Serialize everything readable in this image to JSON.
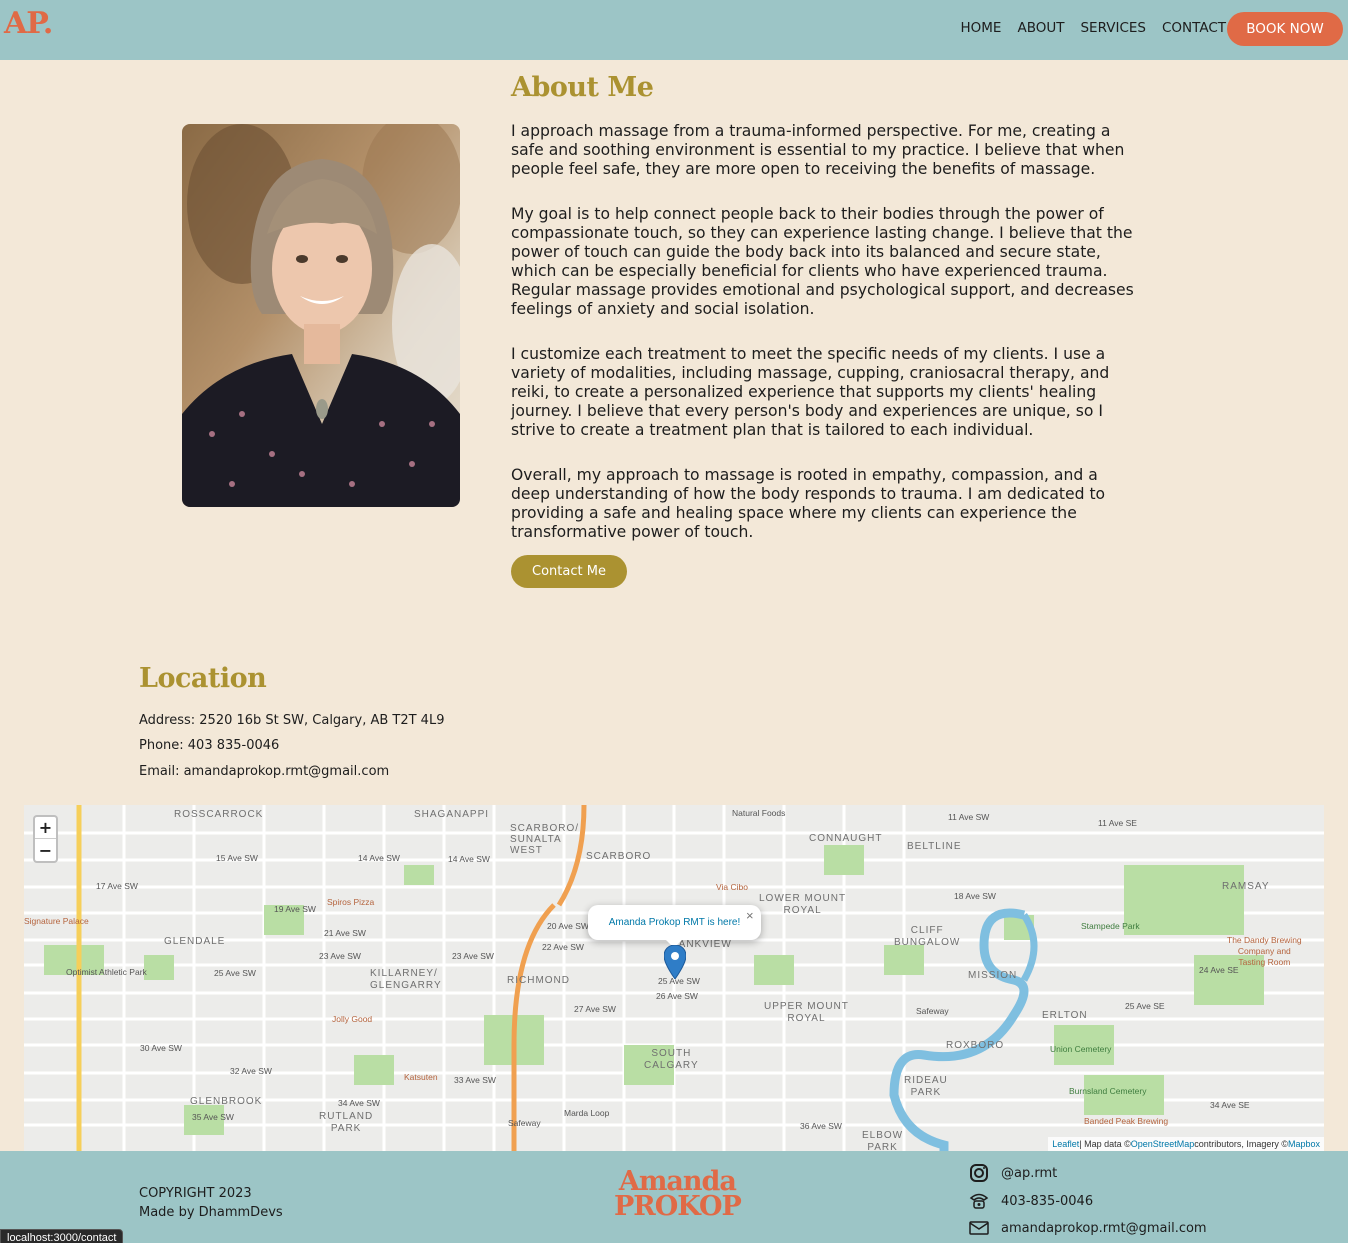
{
  "header": {
    "logo": "AP.",
    "nav": [
      "HOME",
      "ABOUT",
      "SERVICES",
      "CONTACT"
    ],
    "cta": "BOOK NOW"
  },
  "about": {
    "title": "About Me",
    "paragraphs": [
      "I approach massage from a trauma-informed perspective. For me, creating a safe and soothing environment is essential to my practice. I believe that when people feel safe, they are more open to receiving the benefits of massage.",
      "My goal is to help connect people back to their bodies through the power of compassionate touch, so they can experience lasting change. I believe that the power of touch can guide the body back into its balanced and secure state, which can be especially beneficial for clients who have experienced trauma. Regular massage provides emotional and psychological support, and decreases feelings of anxiety and social isolation.",
      "I customize each treatment to meet the specific needs of my clients. I use a variety of modalities, including massage, cupping, craniosacral therapy, and reiki, to create a personalized experience that supports my clients' healing journey. I believe that every person's body and experiences are unique, so I strive to create a treatment plan that is tailored to each individual.",
      "Overall, my approach to massage is rooted in empathy, compassion, and a deep understanding of how the body responds to trauma. I am dedicated to providing a safe and healing space where my clients can experience the transformative power of touch."
    ],
    "contact_button": "Contact Me"
  },
  "location": {
    "title": "Location",
    "address": "Address: 2520 16b St SW, Calgary, AB T2T 4L9",
    "phone": "Phone: 403 835-0046",
    "email": "Email: amandaprokop.rmt@gmail.com"
  },
  "map": {
    "zoom_in": "+",
    "zoom_out": "−",
    "popup_text": "Amanda Prokop RMT is here!",
    "popup_close": "×",
    "attribution_leaflet": "Leaflet",
    "attribution_mid": " | Map data © ",
    "attribution_osm": "OpenStreetMap",
    "attribution_mid2": " contributors, Imagery © ",
    "attribution_mapbox": "Mapbox",
    "labels": {
      "rosscarrock": "ROSSCARROCK",
      "shaganappi": "SHAGANAPPI",
      "scarboro_sunalta": "SCARBORO/\nSUNALTA\nWEST",
      "scarboro": "SCARBORO",
      "natural_foods": "Natural Foods",
      "connaught": "CONNAUGHT",
      "beltline": "BELTLINE",
      "lower_mount_royal": "LOWER MOUNT\nROYAL",
      "cliff_bungalow": "CLIFF\nBUNGALOW",
      "ramsay": "RAMSAY",
      "stampede_park": "Stampede Park",
      "dandy": "The Dandy Brewing\nCompany and\nTasting Room",
      "glendale": "GLENDALE",
      "killarney": "KILLARNEY/\nGLENGARRY",
      "richmond": "RICHMOND",
      "bankview": "BANKVIEW",
      "mission": "MISSION",
      "erlton": "ERLTON",
      "upper_mount_royal": "UPPER MOUNT\nROYAL",
      "roxboro": "ROXBORO",
      "union_cemetery": "Union Cemetery",
      "rideau_park": "RIDEAU\nPARK",
      "burnsland": "Burnsland Cemetery",
      "banded_peak": "Banded Peak Brewing",
      "south_calgary": "SOUTH\nCALGARY",
      "glenbrook": "GLENBROOK",
      "rutland_park": "RUTLAND\nPARK",
      "elbow_park": "ELBOW\nPARK",
      "marda_loop": "Marda Loop",
      "safeway1": "Safeway",
      "safeway2": "Safeway",
      "signature_palace": "Signature Palace",
      "optimist": "Optimist Athletic Park",
      "spiros": "Spiros Pizza",
      "via_cibo": "Via Cibo",
      "jolly_good": "Jolly Good",
      "katsuten": "Katsuten",
      "ave_17": "17 Ave SW",
      "ave_15": "15 Ave SW",
      "ave_14": "14 Ave SW",
      "ave_14b": "14 Ave SW",
      "ave_19": "19 Ave SW",
      "ave_21": "21 Ave SW",
      "ave_23": "23 Ave SW",
      "ave_23b": "23 Ave SW",
      "ave_25": "25 Ave SW",
      "ave_25b": "25 Ave SW",
      "ave_26": "26 Ave SW",
      "ave_27": "27 Ave SW",
      "ave_30": "30 Ave SW",
      "ave_32": "32 Ave SW",
      "ave_33": "33 Ave SW",
      "ave_34": "34 Ave SW",
      "ave_35": "35 Ave SW",
      "ave_36": "36 Ave SW",
      "ave_11": "11 Ave SW",
      "ave_11se": "11 Ave SE",
      "ave_24se": "24 Ave SE",
      "ave_25se": "25 Ave SE",
      "ave_34se": "34 Ave SE",
      "ave_18": "18 Ave SW",
      "ave_20": "20 Ave SW",
      "ave_22": "22 Ave SW"
    }
  },
  "footer": {
    "copyright": "COPYRIGHT 2023",
    "made_by": "Made by DhammDevs",
    "logo_top": "Amanda",
    "logo_bottom": "PROKOP",
    "instagram": "@ap.rmt",
    "phone": "403-835-0046",
    "email": "amandaprokop.rmt@gmail.com"
  },
  "status_url": "localhost:3000/contact"
}
